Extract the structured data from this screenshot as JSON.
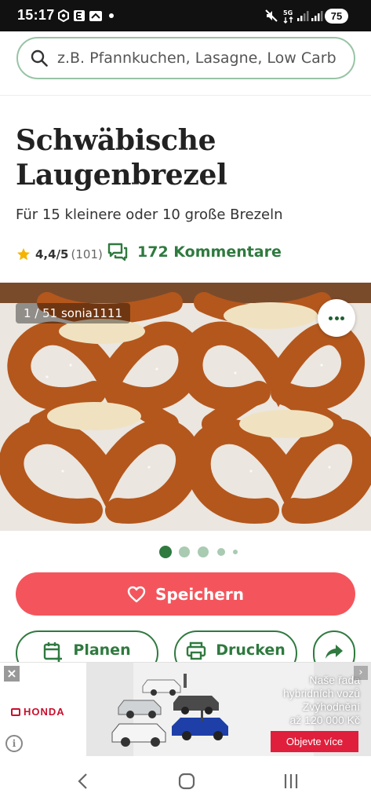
{
  "status_bar": {
    "time": "15:17",
    "battery": "75"
  },
  "search": {
    "placeholder": "z.B. Pfannkuchen, Lasagne, Low Carb"
  },
  "recipe": {
    "title": "Schwäbische Laugenbrezel",
    "subtitle": "Für 15 kleinere oder 10 große Brezeln",
    "rating": "4,4/5",
    "rating_count": "(101)",
    "comments": "172 Kommentare"
  },
  "gallery": {
    "counter": "1 / 51 sonia1111",
    "page_count": 5,
    "current_index": 0
  },
  "actions": {
    "save_label": "Speichern",
    "plan_label": "Planen",
    "print_label": "Drucken"
  },
  "ad": {
    "brand": "HONDA",
    "line1": "Naše řada",
    "line2": "hybridních vozů",
    "line3": "Zvýhodnění",
    "line4": "až 120 000 Kč",
    "cta": "Objevte více"
  },
  "colors": {
    "accent_green": "#2f7a3f",
    "save_red": "#f4555d",
    "star": "#f5b400"
  },
  "icons": [
    "search-icon",
    "star-icon",
    "comments-icon",
    "heart-icon",
    "calendar-icon",
    "printer-icon",
    "share-icon",
    "more-icon",
    "close-icon",
    "info-icon",
    "back-icon",
    "home-icon",
    "recents-icon"
  ]
}
